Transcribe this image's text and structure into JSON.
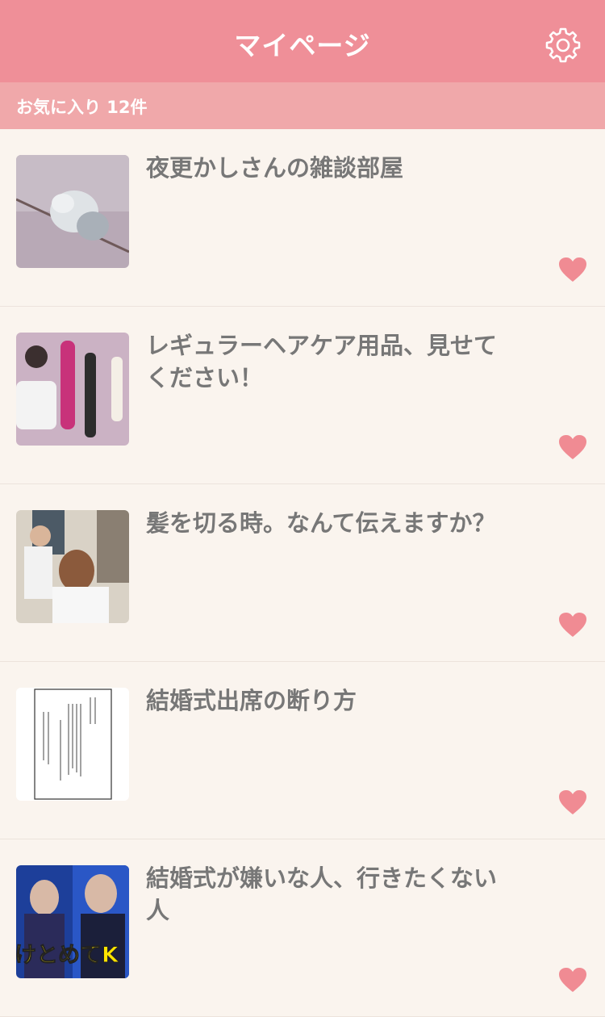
{
  "header": {
    "title": "マイページ",
    "settings_icon": "gear-icon"
  },
  "favorites": {
    "label": "お気に入り 12件"
  },
  "items": [
    {
      "title": "夜更かしさんの雑談部屋",
      "favorited": true
    },
    {
      "title": "レギュラーヘアケア用品、見せてください！",
      "favorited": true
    },
    {
      "title": "髪を切る時。なんて伝えますか？",
      "favorited": true
    },
    {
      "title": "結婚式出席の断り方",
      "favorited": true
    },
    {
      "title": "結婚式が嫌いな人、行きたくない人",
      "favorited": true
    }
  ],
  "thumb5_caption": "けとめてK",
  "colors": {
    "accent": "#ef8f98",
    "subheader": "#f0a8aa",
    "heart": "#f08b93",
    "background": "#faf4ee"
  }
}
